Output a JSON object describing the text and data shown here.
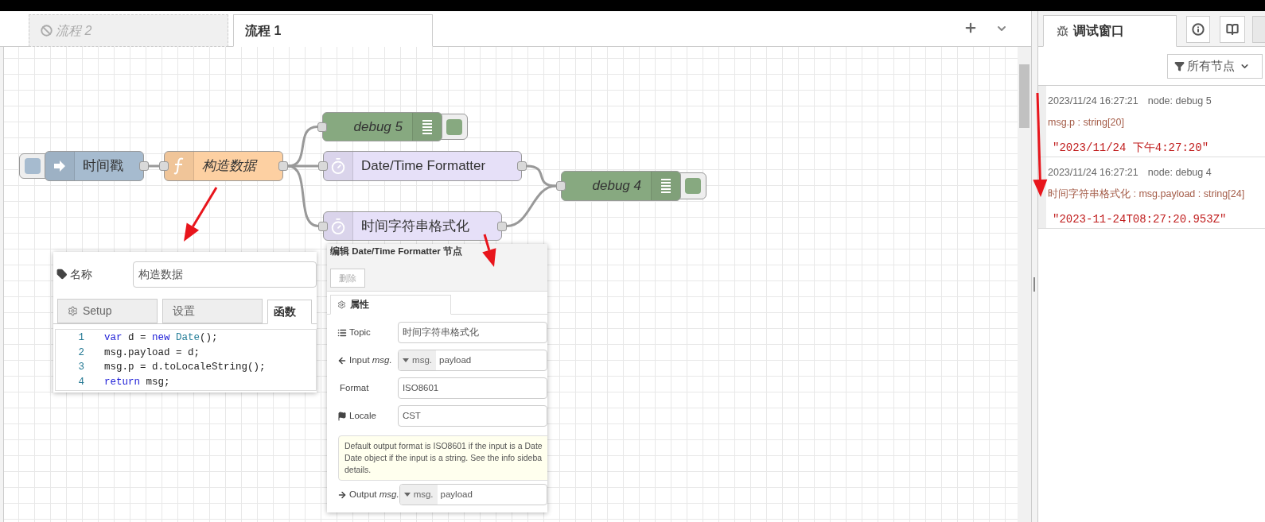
{
  "flow_tabs": [
    {
      "label": "流程 2",
      "selected": false,
      "disabled": true
    },
    {
      "label": "流程 1",
      "selected": true,
      "disabled": false
    }
  ],
  "nodes": [
    {
      "kind": "inject",
      "label": "时间戳"
    },
    {
      "kind": "function",
      "label": "构造数据"
    },
    {
      "kind": "debug",
      "label": "debug 5"
    },
    {
      "kind": "formatter",
      "label": "Date/Time Formatter"
    },
    {
      "kind": "formatter",
      "label": "时间字符串格式化"
    },
    {
      "kind": "debug",
      "label": "debug 4"
    }
  ],
  "function_panel": {
    "name_label": "名称",
    "name_value": "构造数据",
    "tabs": [
      {
        "label": "Setup",
        "selected": false
      },
      {
        "label": "设置",
        "selected": false
      },
      {
        "label": "函数",
        "selected": true
      }
    ],
    "code": [
      {
        "number": "1",
        "tokens": [
          {
            "text": "var",
            "kind": "keyword"
          },
          {
            "text": " d = ",
            "kind": "plain"
          },
          {
            "text": "new",
            "kind": "keyword"
          },
          {
            "text": " Date",
            "kind": "type"
          },
          {
            "text": "();",
            "kind": "plain"
          }
        ]
      },
      {
        "number": "2",
        "tokens": [
          {
            "text": "msg.payload = d;",
            "kind": "plain"
          }
        ]
      },
      {
        "number": "3",
        "tokens": [
          {
            "text": "msg.p = d.toLocaleString();",
            "kind": "plain"
          }
        ]
      },
      {
        "number": "4",
        "tokens": [
          {
            "text": "return",
            "kind": "keyword"
          },
          {
            "text": " msg;",
            "kind": "plain"
          }
        ]
      }
    ]
  },
  "formatter_panel": {
    "title": "编辑 Date/Time Formatter 节点",
    "delete_button": "删除",
    "tab": {
      "label": "属性",
      "selected": true
    },
    "fields": [
      {
        "kind": "text",
        "label": "Topic",
        "value": "时间字符串格式化"
      },
      {
        "kind": "typed",
        "label": "Input *msg.*",
        "type_prefix": "msg.",
        "value": "payload"
      },
      {
        "kind": "text",
        "label": "Format",
        "value": "ISO8601"
      },
      {
        "kind": "text",
        "label": "Locale",
        "value": "CST"
      }
    ],
    "tip": [
      "Default output format is ISO8601 if the input is a Date",
      "Date object if the input is a string. See the info sideba",
      "details."
    ],
    "output": {
      "kind": "typed",
      "label": "Output *msg.*",
      "type_prefix": "msg.",
      "value": "payload"
    }
  },
  "sidebar": {
    "tabs": [
      {
        "label": "调试窗口",
        "selected": true
      }
    ],
    "filter": "所有节点",
    "messages": [
      {
        "time": "2023/11/24 16:27:21",
        "node": "node: debug 5",
        "path": "msg.p : string[20]",
        "value": "\"2023/11/24 下午4:27:20\""
      },
      {
        "time": "2023/11/24 16:27:21",
        "node": "node: debug 4",
        "path": "时间字符串格式化 : msg.payload : string[24]",
        "value": "\"2023-11-24T08:27:20.953Z\""
      }
    ]
  }
}
